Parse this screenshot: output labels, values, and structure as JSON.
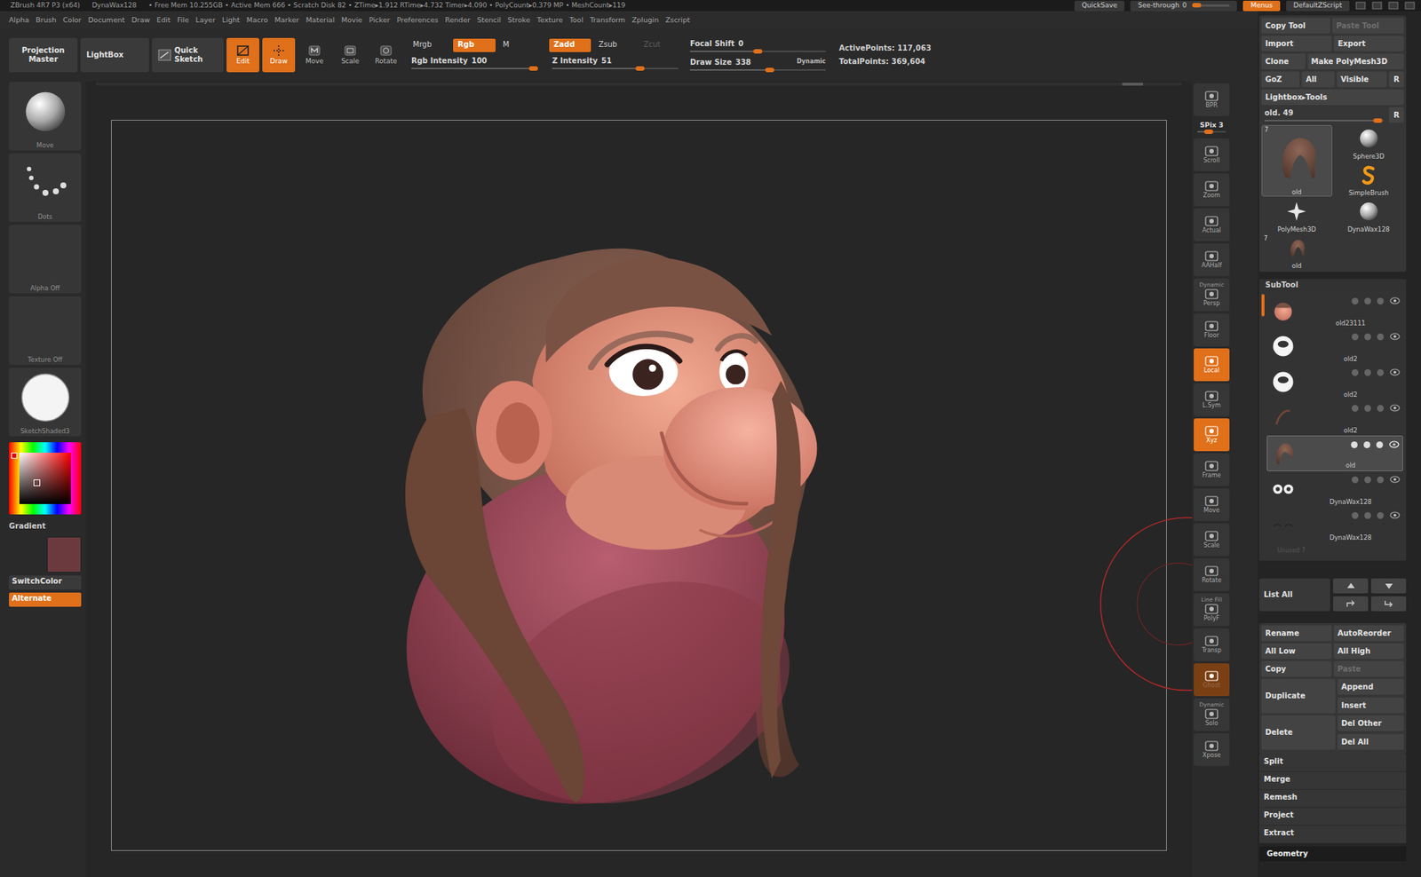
{
  "title_bar": {
    "app": "ZBrush 4R7 P3 (x64)",
    "tool": "DynaWax128",
    "stats": "• Free Mem 10.255GB • Active Mem 666 • Scratch Disk 82 • ZTime▸1.912 RTime▸4.732 Timer▸4.090 • PolyCount▸0.379 MP • MeshCount▸119",
    "quicksave": "QuickSave",
    "see_through": {
      "label": "See-through",
      "reading": "0",
      "level": 0
    },
    "menus": {
      "label": "Menus",
      "selected": true
    },
    "script": "DefaultZScript"
  },
  "menu": [
    "Alpha",
    "Brush",
    "Color",
    "Document",
    "Draw",
    "Edit",
    "File",
    "Layer",
    "Light",
    "Macro",
    "Marker",
    "Material",
    "Movie",
    "Picker",
    "Preferences",
    "Render",
    "Stencil",
    "Stroke",
    "Texture",
    "Tool",
    "Transform",
    "Zplugin",
    "Zscript"
  ],
  "top_shelf": {
    "buttons": [
      "Projection Master",
      "LightBox",
      "Quick Sketch"
    ],
    "modes": [
      {
        "label": "Edit",
        "selected": true
      },
      {
        "label": "Draw",
        "selected": true
      },
      {
        "label": "Move",
        "selected": false
      },
      {
        "label": "Scale",
        "selected": false
      },
      {
        "label": "Rotate",
        "selected": false
      }
    ],
    "color_modes": [
      {
        "label": "Mrgb",
        "selected": false
      },
      {
        "label": "Rgb",
        "selected": true
      },
      {
        "label": "M",
        "selected": false
      }
    ],
    "z_modes": [
      {
        "label": "Zadd",
        "selected": true,
        "disabled": false
      },
      {
        "label": "Zsub",
        "selected": false,
        "disabled": false
      },
      {
        "label": "Zcut",
        "selected": false,
        "disabled": true
      }
    ],
    "sliders": [
      {
        "label": "Rgb Intensity",
        "reading": "100",
        "level": 0.97
      },
      {
        "label": "Z Intensity",
        "reading": "51",
        "level": 0.7
      },
      {
        "label": "Focal Shift",
        "reading": "0",
        "level": 0.5
      },
      {
        "label": "Draw Size",
        "reading": "338",
        "level": 0.59
      }
    ],
    "dynamic": "Dynamic",
    "stats": [
      "ActivePoints: 117,063",
      "TotalPoints: 369,604"
    ]
  },
  "left_shelf": {
    "thumbs": [
      {
        "label": "Move",
        "kind": "brush"
      },
      {
        "label": "Dots",
        "kind": "stroke"
      },
      {
        "label": "Alpha Off",
        "kind": "empty"
      },
      {
        "label": "Texture Off",
        "kind": "empty"
      },
      {
        "label": "SketchShaded3",
        "kind": "material"
      }
    ],
    "gradient": "Gradient",
    "swatch_color": "#6b3a3f",
    "buttons": [
      {
        "label": "SwitchColor",
        "selected": false
      },
      {
        "label": "Alternate",
        "selected": true
      }
    ]
  },
  "right_shelf": [
    {
      "label": "BPR",
      "kind": "button",
      "selected": false,
      "disabled": false
    },
    {
      "label": "SPix 3",
      "kind": "slider",
      "level": 0.4
    },
    {
      "label": "Scroll",
      "kind": "button",
      "selected": false,
      "disabled": false
    },
    {
      "label": "Zoom",
      "kind": "button",
      "selected": false,
      "disabled": false
    },
    {
      "label": "Actual",
      "kind": "button",
      "selected": false,
      "disabled": false
    },
    {
      "label": "AAHalf",
      "kind": "button",
      "selected": false,
      "disabled": false
    },
    {
      "caption": "Dynamic",
      "label": "Persp",
      "kind": "button",
      "selected": false,
      "disabled": false
    },
    {
      "label": "Floor",
      "kind": "button",
      "selected": false,
      "disabled": false
    },
    {
      "label": "Local",
      "kind": "button",
      "selected": true,
      "disabled": false
    },
    {
      "label": "L.Sym",
      "kind": "button",
      "selected": false,
      "disabled": false
    },
    {
      "label": "Xyz",
      "kind": "button",
      "selected": true,
      "disabled": false
    },
    {
      "label": "Frame",
      "kind": "button",
      "selected": false,
      "disabled": false
    },
    {
      "label": "Move",
      "kind": "button",
      "selected": false,
      "disabled": false
    },
    {
      "label": "Scale",
      "kind": "button",
      "selected": false,
      "disabled": false
    },
    {
      "label": "Rotate",
      "kind": "button",
      "selected": false,
      "disabled": false
    },
    {
      "caption": "Line Fill",
      "label": "PolyF",
      "kind": "button",
      "selected": false,
      "disabled": false
    },
    {
      "label": "Transp",
      "kind": "button",
      "selected": false,
      "disabled": false
    },
    {
      "label": "Ghost",
      "kind": "button",
      "selected": true,
      "disabled": true
    },
    {
      "caption": "Dynamic",
      "label": "Solo",
      "kind": "button",
      "selected": false,
      "disabled": false
    },
    {
      "label": "Xpose",
      "kind": "button",
      "selected": false,
      "disabled": false
    }
  ],
  "tool_panel": {
    "rows": [
      [
        {
          "label": "Copy Tool",
          "disabled": false
        },
        {
          "label": "Paste Tool",
          "disabled": true
        }
      ],
      [
        {
          "label": "Import",
          "disabled": false
        },
        {
          "label": "Export",
          "disabled": false
        }
      ],
      [
        {
          "label": "Clone",
          "disabled": false
        },
        {
          "label": "Make PolyMesh3D",
          "disabled": false
        }
      ],
      [
        {
          "label": "GoZ",
          "disabled": false
        },
        {
          "label": "All",
          "disabled": false
        },
        {
          "label": "Visible",
          "disabled": false
        },
        {
          "label": "R",
          "disabled": false
        }
      ]
    ],
    "lightbox": "Lightbox▸Tools",
    "current": {
      "label": "old. 49",
      "level": 0.95,
      "r": "R"
    },
    "tools": [
      {
        "label": "old",
        "count": "7",
        "kind": "hair",
        "selected": true
      },
      {
        "label": "Sphere3D",
        "kind": "sphere",
        "selected": false
      },
      {
        "label": "SimpleBrush",
        "kind": "brush",
        "selected": false
      },
      {
        "label": "PolyMesh3D",
        "kind": "star",
        "selected": false
      },
      {
        "label": "DynaWax128",
        "kind": "sphere",
        "selected": false
      },
      {
        "label": "old",
        "count": "7",
        "kind": "hair-small",
        "selected": false
      }
    ]
  },
  "subtool": {
    "title": "SubTool",
    "items": [
      {
        "name": "old23111",
        "kind": "head",
        "visible": true,
        "selected": false
      },
      {
        "name": "old2",
        "kind": "eye",
        "visible": true,
        "selected": false
      },
      {
        "name": "old2",
        "kind": "eye",
        "visible": true,
        "selected": false
      },
      {
        "name": "old2",
        "kind": "brow",
        "visible": true,
        "selected": false
      },
      {
        "name": "old",
        "kind": "hair",
        "visible": true,
        "selected": true
      },
      {
        "name": "DynaWax128",
        "kind": "eyes",
        "visible": true,
        "selected": false
      },
      {
        "name": "DynaWax128",
        "kind": "lashes",
        "visible": true,
        "selected": false
      }
    ],
    "unused": "Unused 7",
    "list_all": "List All",
    "actions": [
      [
        {
          "label": "Rename",
          "disabled": false
        },
        {
          "label": "AutoReorder",
          "disabled": false
        }
      ],
      [
        {
          "label": "All Low",
          "disabled": false
        },
        {
          "label": "All High",
          "disabled": false
        }
      ],
      [
        {
          "label": "Copy",
          "disabled": false
        },
        {
          "label": "Paste",
          "disabled": true
        }
      ]
    ],
    "groups": [
      {
        "label": "Duplicate",
        "options": [
          "Append",
          "Insert"
        ]
      },
      {
        "label": "Delete",
        "options": [
          "Del Other",
          "Del All"
        ]
      }
    ],
    "menus": [
      "Split",
      "Merge",
      "Remesh",
      "Project",
      "Extract"
    ]
  },
  "geometry": "Geometry"
}
